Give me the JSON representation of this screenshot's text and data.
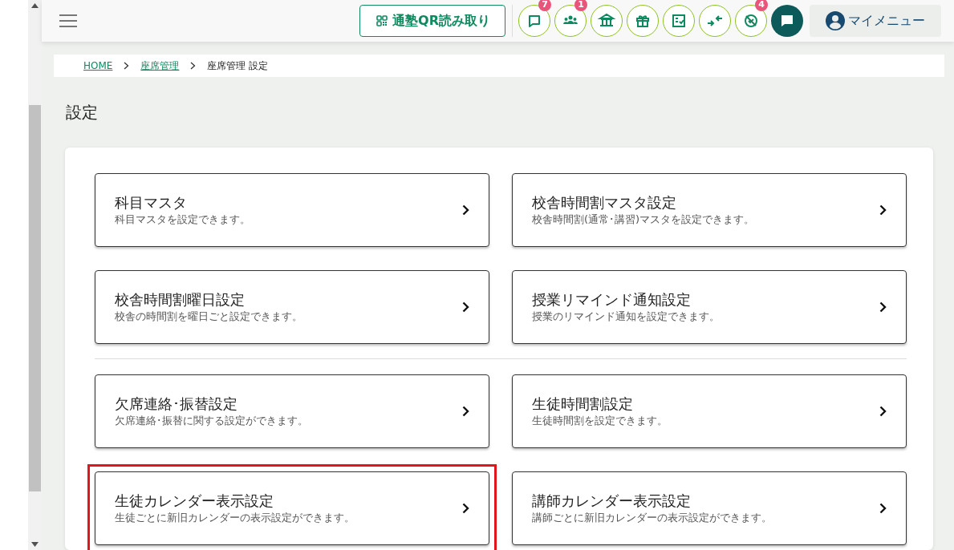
{
  "header": {
    "qr_button": "通塾QR読み取り",
    "icon_buttons": [
      {
        "kind": "chat",
        "badge": "7"
      },
      {
        "kind": "people",
        "badge": "1"
      },
      {
        "kind": "building"
      },
      {
        "kind": "gift"
      },
      {
        "kind": "checklist"
      },
      {
        "kind": "compress"
      },
      {
        "kind": "blocked",
        "badge": "4"
      }
    ],
    "my_menu": "マイメニュー"
  },
  "breadcrumb": [
    {
      "label": "HOME",
      "link": true
    },
    {
      "label": "座席管理",
      "link": true
    },
    {
      "label": "座席管理 設定",
      "link": false
    }
  ],
  "page_title": "設定",
  "sections": [
    {
      "cards": [
        {
          "title": "科目マスタ",
          "description": "科目マスタを設定できます。",
          "highlighted": false
        },
        {
          "title": "校舎時間割マスタ設定",
          "description": "校舎時間割(通常･講習)マスタを設定できます。",
          "highlighted": false
        },
        {
          "title": "校舎時間割曜日設定",
          "description": "校舎の時間割を曜日ごと設定できます。",
          "highlighted": false
        },
        {
          "title": "授業リマインド通知設定",
          "description": "授業のリマインド通知を設定できます。",
          "highlighted": false
        }
      ]
    },
    {
      "cards": [
        {
          "title": "欠席連絡･振替設定",
          "description": "欠席連絡･振替に関する設定ができます。",
          "highlighted": false
        },
        {
          "title": "生徒時間割設定",
          "description": "生徒時間割を設定できます。",
          "highlighted": false
        },
        {
          "title": "生徒カレンダー表示設定",
          "description": "生徒ごとに新旧カレンダーの表示設定ができます。",
          "highlighted": true
        },
        {
          "title": "講師カレンダー表示設定",
          "description": "講師ごとに新旧カレンダーの表示設定ができます。",
          "highlighted": false
        }
      ]
    }
  ]
}
